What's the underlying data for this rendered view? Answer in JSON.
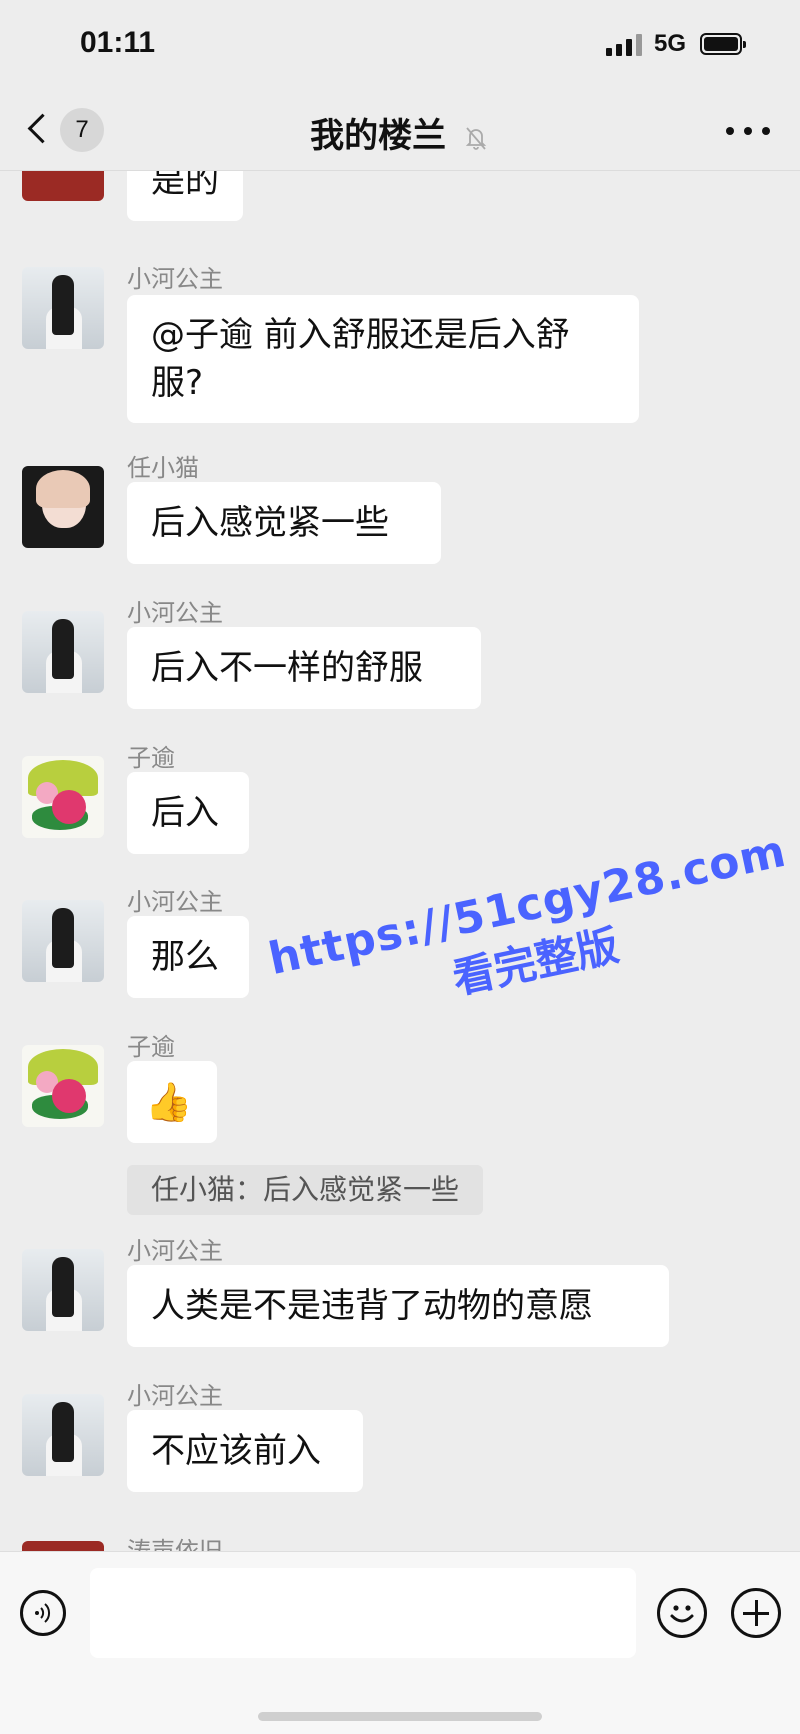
{
  "status_bar": {
    "time": "01:11",
    "network": "5G"
  },
  "nav": {
    "unread_count": "7",
    "title": "我的楼兰"
  },
  "messages": [
    {
      "sender": "",
      "text": "是的"
    },
    {
      "sender": "小河公主",
      "line1": "@子逾 前入舒服还是后入舒",
      "line2": "服?"
    },
    {
      "sender": "任小猫",
      "text": "后入感觉紧一些"
    },
    {
      "sender": "小河公主",
      "text": "后入不一样的舒服"
    },
    {
      "sender": "子逾",
      "text": "后入"
    },
    {
      "sender": "小河公主",
      "text": "那么"
    },
    {
      "sender": "子逾",
      "emoji": "👍",
      "quote": "任小猫：后入感觉紧一些"
    },
    {
      "sender": "小河公主",
      "text": "人类是不是违背了动物的意愿"
    },
    {
      "sender": "小河公主",
      "text": "不应该前入"
    },
    {
      "sender": "涛声依旧"
    }
  ],
  "watermark": {
    "url": "https://51cgy28.com",
    "cta": "看完整版"
  },
  "input_bar": {
    "placeholder": ""
  }
}
